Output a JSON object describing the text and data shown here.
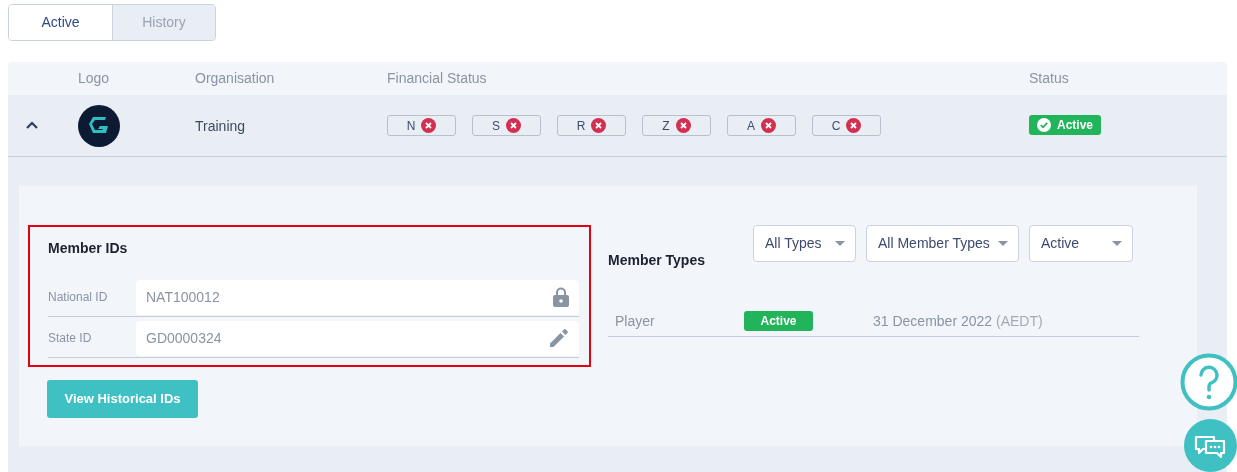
{
  "tabs": [
    {
      "label": "Active",
      "selected": true
    },
    {
      "label": "History",
      "selected": false
    }
  ],
  "table": {
    "columns": [
      "Logo",
      "Organisation",
      "Financial Status",
      "Status"
    ],
    "rows": [
      {
        "expanded": true,
        "organisation": "Training",
        "financial_status": [
          {
            "label": "N",
            "paid": false
          },
          {
            "label": "S",
            "paid": false
          },
          {
            "label": "R",
            "paid": false
          },
          {
            "label": "Z",
            "paid": false
          },
          {
            "label": "A",
            "paid": false
          },
          {
            "label": "C",
            "paid": false
          }
        ],
        "status": "Active"
      }
    ]
  },
  "member_ids": {
    "title": "Member IDs",
    "fields": [
      {
        "label": "National ID",
        "value": "NAT100012",
        "kind": "locked"
      },
      {
        "label": "State ID",
        "value": "GD0000324",
        "kind": "editable"
      }
    ],
    "button": "View Historical IDs"
  },
  "member_types": {
    "title": "Member Types",
    "filters": [
      "All Types",
      "All Member Types",
      "Active"
    ],
    "rows": [
      {
        "type": "Player",
        "status": "Active",
        "date": "31 December 2022",
        "timezone": "(AEDT)"
      }
    ]
  }
}
